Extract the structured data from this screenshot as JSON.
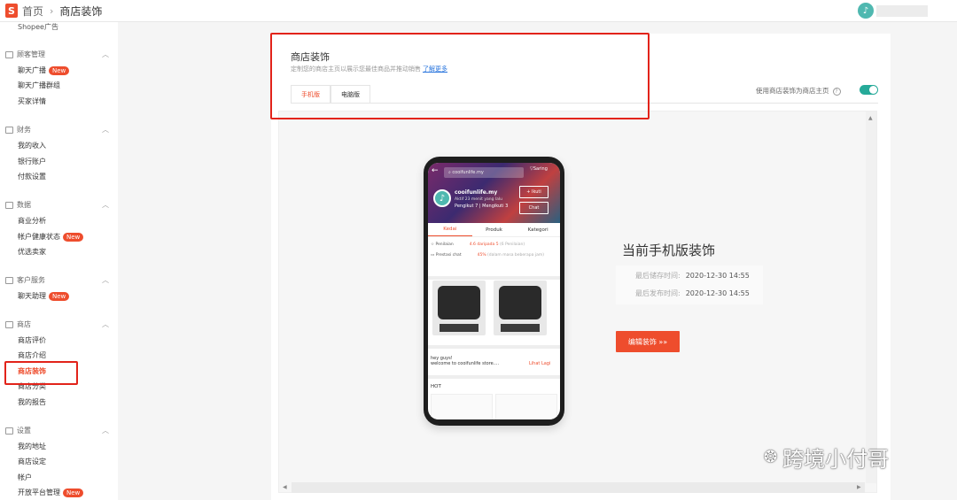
{
  "topbar": {
    "logo_letter": "S",
    "crumb_home": "首页",
    "crumb_sep": "›",
    "crumb_current": "商店装饰",
    "avatar_glyph": "♪"
  },
  "sidebar": {
    "top_cut": "Shopee广告",
    "badge_new": "New",
    "sections": [
      {
        "title": "顾客管理",
        "items": [
          "聊天广播",
          "聊天广播群组",
          "买家详情"
        ]
      },
      {
        "title": "财务",
        "items": [
          "我的收入",
          "银行账户",
          "付款设置"
        ]
      },
      {
        "title": "数据",
        "items": [
          "商业分析",
          "帐户健康状态",
          "优选卖家"
        ]
      },
      {
        "title": "客户服务",
        "items": [
          "聊天助理"
        ]
      },
      {
        "title": "商店",
        "items": [
          "商店评价",
          "商店介绍",
          "商店装饰",
          "商店分类",
          "我的报告"
        ]
      },
      {
        "title": "设置",
        "items": [
          "我的地址",
          "商店设定",
          "帐户",
          "开放平台管理"
        ]
      }
    ]
  },
  "panel": {
    "title": "商店装饰",
    "description": "定制您的商店主页以展示您最佳商品并推动销售",
    "learn_more": "了解更多",
    "tabs": [
      "手机版",
      "电脑版"
    ],
    "toggle_label": "使用商店装饰为商店主页",
    "help_glyph": "?"
  },
  "phone": {
    "search_text": "cooifunlife.my",
    "filter_text": "Saring",
    "shop_name": "cooifunlife.my",
    "shop_meta": "Aktif 23 menit yang lalu",
    "follow_meta": "Pengikut 7 | Mengikuti 3",
    "follow_btn": "+ Ikuti",
    "chat_btn": "Chat",
    "tabs": [
      "Kedai",
      "Produk",
      "Kategori"
    ],
    "rating_label": "Penilaian",
    "rating_value": "4.6 daripada 5",
    "rating_count": "(6 Penilaian)",
    "chat_label": "Prestasi chat",
    "chat_value": "45%",
    "chat_desc": "(dalam masa beberapa jam)",
    "product_brand": "cooifunlife",
    "welcome_line1": "hey guys!",
    "welcome_line2": "welcome to cooifunlife store....",
    "lihat": "Lihat Lagi",
    "hot": "HOT"
  },
  "current": {
    "title": "当前手机版装饰",
    "saved_label": "最后储存时间:",
    "saved_time": "2020-12-30 14:55",
    "published_label": "最后发布时间:",
    "published_time": "2020-12-30 14:55",
    "edit_button": "编辑装饰",
    "edit_arrow": "»»"
  },
  "watermark": {
    "text": "跨境小付哥",
    "icon": "wechat-icon"
  }
}
